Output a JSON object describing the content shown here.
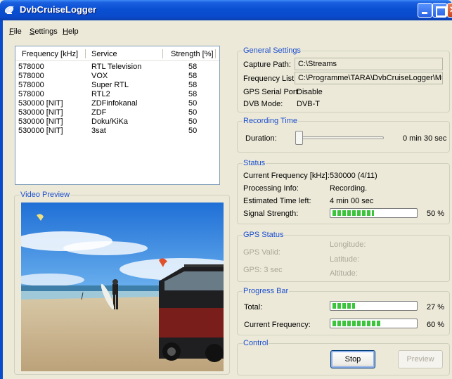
{
  "window": {
    "title": "DvbCruiseLogger",
    "icon": "satellite-dish-icon"
  },
  "menu": [
    {
      "prefix": "",
      "hot": "F",
      "rest": "ile"
    },
    {
      "prefix": "",
      "hot": "S",
      "rest": "ettings"
    },
    {
      "prefix": "",
      "hot": "H",
      "rest": "elp"
    }
  ],
  "list": {
    "columns": [
      "Frequency [kHz]",
      "Service",
      "Strength [%]"
    ],
    "rows": [
      {
        "freq": "578000",
        "service": "RTL Television",
        "strength": "58"
      },
      {
        "freq": "578000",
        "service": "VOX",
        "strength": "58"
      },
      {
        "freq": "578000",
        "service": "Super RTL",
        "strength": "58"
      },
      {
        "freq": "578000",
        "service": "RTL2",
        "strength": "58"
      },
      {
        "freq": "530000 [NIT]",
        "service": "ZDFinfokanal",
        "strength": "50"
      },
      {
        "freq": "530000 [NIT]",
        "service": "ZDF",
        "strength": "50"
      },
      {
        "freq": "530000 [NIT]",
        "service": "Doku/KiKa",
        "strength": "50"
      },
      {
        "freq": "530000 [NIT]",
        "service": "3sat",
        "strength": "50"
      }
    ]
  },
  "video_preview": {
    "title": "Video Preview"
  },
  "general": {
    "title": "General Settings",
    "capture_label": "Capture Path:",
    "capture_value": "C:\\Streams",
    "freqlist_label": "Frequency List:",
    "freqlist_value": "C:\\Programme\\TARA\\DvbCruiseLogger\\Munich.txt",
    "gps_port_label": "GPS Serial Port:",
    "gps_port_value": "Disable",
    "dvb_label": "DVB Mode:",
    "dvb_value": "DVB-T"
  },
  "recording": {
    "title": "Recording Time",
    "duration_label": "Duration:",
    "duration_value": "0 min 30 sec",
    "slider_fraction": 0.0
  },
  "status": {
    "title": "Status",
    "current_freq_label": "Current Frequency [kHz]:",
    "current_freq_value": "530000 (4/11)",
    "processing_label": "Processing Info:",
    "processing_value": "Recording.",
    "time_left_label": "Estimated Time left:",
    "time_left_value": "4 min 00 sec",
    "signal_label": "Signal Strength:",
    "signal_value": "50 %",
    "signal_fraction": 0.5
  },
  "gps": {
    "title": "GPS Status",
    "valid_label": "GPS Valid:",
    "sats_label": "GPS: 3 sec",
    "longitude_label": "Longitude:",
    "latitude_label": "Latitude:",
    "altitude_label": "Altitude:"
  },
  "progress": {
    "title": "Progress Bar",
    "total_label": "Total:",
    "total_value": "27 %",
    "total_fraction": 0.27,
    "current_label": "Current Frequency:",
    "current_value": "60 %",
    "current_fraction": 0.6
  },
  "control": {
    "title": "Control",
    "stop_label": "Stop",
    "preview_label": "Preview"
  },
  "colors": {
    "group_title": "#1c4fd0",
    "progress_green": "#3cc43c",
    "titlebar": "#0a4bcc"
  }
}
